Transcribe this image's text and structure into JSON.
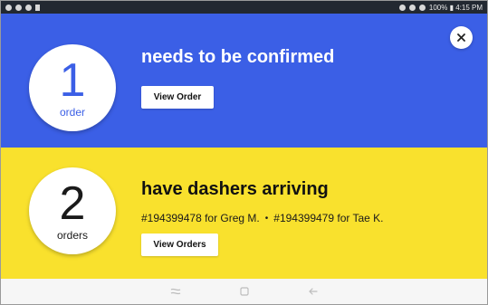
{
  "status_bar": {
    "right_text": "100% ▮ 4:15 PM",
    "icons_left": [
      "android-debug-icon",
      "notification-icon",
      "settings-icon",
      "sd-card-icon"
    ],
    "icons_right": [
      "mute-icon",
      "wifi-icon",
      "signal-icon",
      "battery-icon"
    ]
  },
  "confirm_card": {
    "count": "1",
    "unit": "order",
    "headline": "needs to be confirmed",
    "button_label": "View Order",
    "background_color": "#3b5fe6"
  },
  "dashers_card": {
    "count": "2",
    "unit": "orders",
    "headline": "have dashers arriving",
    "orders": [
      {
        "text": "#194399478 for Greg M."
      },
      {
        "text": "#194399479 for Tae K."
      }
    ],
    "separator": "•",
    "button_label": "View Orders",
    "background_color": "#f9e12d"
  },
  "nav_bar": {
    "icons": [
      "recent-apps-icon",
      "home-icon",
      "back-icon"
    ]
  }
}
